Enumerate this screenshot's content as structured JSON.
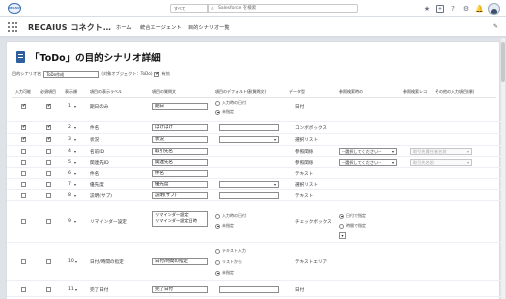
{
  "global": {
    "logo_text": "RECAIUS",
    "scope_label": "すべて",
    "search_placeholder": "Salesforce を検索",
    "icons": [
      "favorites-star-icon",
      "add-plus-icon",
      "help-question-icon",
      "settings-gear-icon",
      "notification-bell-icon",
      "user-avatar"
    ]
  },
  "nav": {
    "app_name": "RECAIUS コネクト…",
    "tabs": [
      "ホーム",
      "統合エージェント",
      "目的シナリオ一覧"
    ]
  },
  "page": {
    "title": "「ToDo」の目的シナリオ詳細"
  },
  "filter": {
    "label": "目的シナリオ名",
    "value": "ToDo作成",
    "object_label": "(対象オブジェクト：ToDo)",
    "active_label": "有効",
    "active_checked": true
  },
  "columns": [
    "入力可能",
    "必須項目",
    "表示順",
    "項目の表示ラベル",
    "項目の質問文",
    "項目のデフォルト値(質問文)",
    "データ型",
    "参照検索時の",
    "参照検索レコ",
    "その他の入力項目(順)"
  ],
  "colors": {
    "accent": "#2e5f9e",
    "header_bg": "#ffffff",
    "page_bg": "#dfe3e8"
  },
  "rows": [
    {
      "inputable": true,
      "required": true,
      "order": "1",
      "label": "期日のみ",
      "question": "期日",
      "type": "日付",
      "default_radio": [
        "入力時の日付",
        "未指定"
      ],
      "default_radio_selected": 1
    },
    {
      "inputable": true,
      "required": true,
      "order": "2",
      "label": "件名",
      "question": "ほげほげ",
      "type": "コンボボックス",
      "default_input": ""
    },
    {
      "inputable": true,
      "required": true,
      "order": "3",
      "label": "状況",
      "question": "状況",
      "type": "選択リスト",
      "default_select": ""
    },
    {
      "inputable": false,
      "required": false,
      "order": "4",
      "label": "名前ID",
      "question": "取引先名",
      "type": "参照関係",
      "ref_select": "--選択してください--",
      "ref_record": "取引先責任者名前"
    },
    {
      "inputable": false,
      "required": false,
      "order": "5",
      "label": "関連先ID",
      "question": "関連先名",
      "type": "参照関係",
      "ref_select": "--選択してください--",
      "ref_record": "取引先名前"
    },
    {
      "inputable": false,
      "required": false,
      "order": "6",
      "label": "件名",
      "question": "件名",
      "type": "テキスト"
    },
    {
      "inputable": false,
      "required": false,
      "order": "7",
      "label": "優先度",
      "question": "優先度",
      "type": "選択リスト",
      "default_select": ""
    },
    {
      "inputable": false,
      "required": false,
      "order": "8",
      "label": "説明(サブ)",
      "question": "説明(サブ)",
      "type": "テキスト",
      "default_input": ""
    },
    {
      "inputable": false,
      "required": false,
      "order": "9",
      "label": "リマインダー設定",
      "question": "リマインダー設定",
      "question2": "リマインダー設定日時",
      "type": "チェックボックス",
      "default_radio": [
        "入力時の日付",
        "未指定"
      ],
      "default_radio_selected": 1,
      "type_radio": [
        "日付で指定",
        "時間で指定"
      ],
      "type_radio_selected": 0
    },
    {
      "inputable": false,
      "required": false,
      "order": "10",
      "label": "日付/時間の指定",
      "question": "日付/時間の指定",
      "type": "テキストエリア",
      "default_radio": [
        "テキスト入力",
        "リストから",
        "未指定"
      ],
      "default_radio_selected": 2
    },
    {
      "inputable": false,
      "required": false,
      "order": "11",
      "label": "完了日付",
      "question": "完了日付",
      "type": "日付",
      "default_input": ""
    }
  ]
}
